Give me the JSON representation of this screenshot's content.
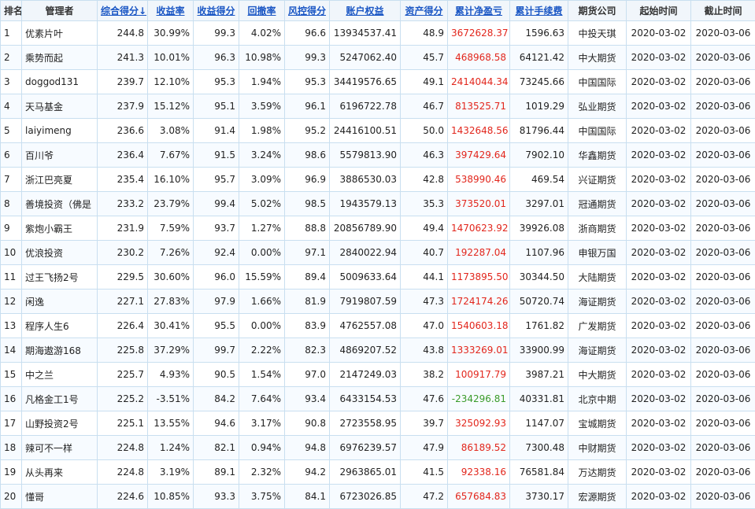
{
  "columns": [
    {
      "label": "排名",
      "sortable": false
    },
    {
      "label": "管理者",
      "sortable": false
    },
    {
      "label": "综合得分↓",
      "sortable": true
    },
    {
      "label": "收益率",
      "sortable": true
    },
    {
      "label": "收益得分",
      "sortable": true
    },
    {
      "label": "回撤率",
      "sortable": true
    },
    {
      "label": "风控得分",
      "sortable": true
    },
    {
      "label": "账户权益",
      "sortable": true
    },
    {
      "label": "资产得分",
      "sortable": true
    },
    {
      "label": "累计净盈亏",
      "sortable": true
    },
    {
      "label": "累计手续费",
      "sortable": true
    },
    {
      "label": "期货公司",
      "sortable": false
    },
    {
      "label": "起始时间",
      "sortable": false
    },
    {
      "label": "截止时间",
      "sortable": false
    }
  ],
  "colors": {
    "profit_positive": "#e2261c",
    "profit_negative": "#3a9b2a",
    "header_link": "#1a56c4",
    "border": "#c9dff0"
  },
  "rows": [
    {
      "rank": "1",
      "manager": "优素片叶",
      "score": "244.8",
      "return": "30.99%",
      "return_score": "99.3",
      "drawdown": "4.02%",
      "risk_score": "96.6",
      "equity": "13934537.41",
      "asset_score": "48.9",
      "net_pnl": "3672628.37",
      "fee": "1596.63",
      "broker": "中投天琪",
      "start": "2020-03-02",
      "end": "2020-03-06"
    },
    {
      "rank": "2",
      "manager": "乘势而起",
      "score": "241.3",
      "return": "10.01%",
      "return_score": "96.3",
      "drawdown": "10.98%",
      "risk_score": "99.3",
      "equity": "5247062.40",
      "asset_score": "45.7",
      "net_pnl": "468968.58",
      "fee": "64121.42",
      "broker": "中大期货",
      "start": "2020-03-02",
      "end": "2020-03-06"
    },
    {
      "rank": "3",
      "manager": "doggod131",
      "score": "239.7",
      "return": "12.10%",
      "return_score": "95.3",
      "drawdown": "1.94%",
      "risk_score": "95.3",
      "equity": "34419576.65",
      "asset_score": "49.1",
      "net_pnl": "2414044.34",
      "fee": "73245.66",
      "broker": "中国国际",
      "start": "2020-03-02",
      "end": "2020-03-06"
    },
    {
      "rank": "4",
      "manager": "天马基金",
      "score": "237.9",
      "return": "15.12%",
      "return_score": "95.1",
      "drawdown": "3.59%",
      "risk_score": "96.1",
      "equity": "6196722.78",
      "asset_score": "46.7",
      "net_pnl": "813525.71",
      "fee": "1019.29",
      "broker": "弘业期货",
      "start": "2020-03-02",
      "end": "2020-03-06"
    },
    {
      "rank": "5",
      "manager": "laiyimeng",
      "score": "236.6",
      "return": "3.08%",
      "return_score": "91.4",
      "drawdown": "1.98%",
      "risk_score": "95.2",
      "equity": "24416100.51",
      "asset_score": "50.0",
      "net_pnl": "1432648.56",
      "fee": "81796.44",
      "broker": "中国国际",
      "start": "2020-03-02",
      "end": "2020-03-06"
    },
    {
      "rank": "6",
      "manager": "百川爷",
      "score": "236.4",
      "return": "7.67%",
      "return_score": "91.5",
      "drawdown": "3.24%",
      "risk_score": "98.6",
      "equity": "5579813.90",
      "asset_score": "46.3",
      "net_pnl": "397429.64",
      "fee": "7902.10",
      "broker": "华鑫期货",
      "start": "2020-03-02",
      "end": "2020-03-06"
    },
    {
      "rank": "7",
      "manager": "浙江巴亮夏",
      "score": "235.4",
      "return": "16.10%",
      "return_score": "95.7",
      "drawdown": "3.09%",
      "risk_score": "96.9",
      "equity": "3886530.03",
      "asset_score": "42.8",
      "net_pnl": "538990.46",
      "fee": "469.54",
      "broker": "兴证期货",
      "start": "2020-03-02",
      "end": "2020-03-06"
    },
    {
      "rank": "8",
      "manager": "善境投资（佛是",
      "score": "233.2",
      "return": "23.79%",
      "return_score": "99.4",
      "drawdown": "5.02%",
      "risk_score": "98.5",
      "equity": "1943579.13",
      "asset_score": "35.3",
      "net_pnl": "373520.01",
      "fee": "3297.01",
      "broker": "冠通期货",
      "start": "2020-03-02",
      "end": "2020-03-06"
    },
    {
      "rank": "9",
      "manager": "紫炮小霸王",
      "score": "231.9",
      "return": "7.59%",
      "return_score": "93.7",
      "drawdown": "1.27%",
      "risk_score": "88.8",
      "equity": "20856789.90",
      "asset_score": "49.4",
      "net_pnl": "1470623.92",
      "fee": "39926.08",
      "broker": "浙商期货",
      "start": "2020-03-02",
      "end": "2020-03-06"
    },
    {
      "rank": "10",
      "manager": "优浪投资",
      "score": "230.2",
      "return": "7.26%",
      "return_score": "92.4",
      "drawdown": "0.00%",
      "risk_score": "97.1",
      "equity": "2840022.94",
      "asset_score": "40.7",
      "net_pnl": "192287.04",
      "fee": "1107.96",
      "broker": "申银万国",
      "start": "2020-03-02",
      "end": "2020-03-06"
    },
    {
      "rank": "11",
      "manager": "过王飞扬2号",
      "score": "229.5",
      "return": "30.60%",
      "return_score": "96.0",
      "drawdown": "15.59%",
      "risk_score": "89.4",
      "equity": "5009633.64",
      "asset_score": "44.1",
      "net_pnl": "1173895.50",
      "fee": "30344.50",
      "broker": "大陆期货",
      "start": "2020-03-02",
      "end": "2020-03-06"
    },
    {
      "rank": "12",
      "manager": "闲逸",
      "score": "227.1",
      "return": "27.83%",
      "return_score": "97.9",
      "drawdown": "1.66%",
      "risk_score": "81.9",
      "equity": "7919807.59",
      "asset_score": "47.3",
      "net_pnl": "1724174.26",
      "fee": "50720.74",
      "broker": "海证期货",
      "start": "2020-03-02",
      "end": "2020-03-06"
    },
    {
      "rank": "13",
      "manager": "程序人生6",
      "score": "226.4",
      "return": "30.41%",
      "return_score": "95.5",
      "drawdown": "0.00%",
      "risk_score": "83.9",
      "equity": "4762557.08",
      "asset_score": "47.0",
      "net_pnl": "1540603.18",
      "fee": "1761.82",
      "broker": "广发期货",
      "start": "2020-03-02",
      "end": "2020-03-06"
    },
    {
      "rank": "14",
      "manager": "期海遨游168",
      "score": "225.8",
      "return": "37.29%",
      "return_score": "99.7",
      "drawdown": "2.22%",
      "risk_score": "82.3",
      "equity": "4869207.52",
      "asset_score": "43.8",
      "net_pnl": "1333269.01",
      "fee": "33900.99",
      "broker": "海证期货",
      "start": "2020-03-02",
      "end": "2020-03-06"
    },
    {
      "rank": "15",
      "manager": "中之兰",
      "score": "225.7",
      "return": "4.93%",
      "return_score": "90.5",
      "drawdown": "1.54%",
      "risk_score": "97.0",
      "equity": "2147249.03",
      "asset_score": "38.2",
      "net_pnl": "100917.79",
      "fee": "3987.21",
      "broker": "中大期货",
      "start": "2020-03-02",
      "end": "2020-03-06"
    },
    {
      "rank": "16",
      "manager": "凡格金工1号",
      "score": "225.2",
      "return": "-3.51%",
      "return_score": "84.2",
      "drawdown": "7.64%",
      "risk_score": "93.4",
      "equity": "6433154.53",
      "asset_score": "47.6",
      "net_pnl": "-234296.81",
      "fee": "40331.81",
      "broker": "北京中期",
      "start": "2020-03-02",
      "end": "2020-03-06"
    },
    {
      "rank": "17",
      "manager": "山野投资2号",
      "score": "225.1",
      "return": "13.55%",
      "return_score": "94.6",
      "drawdown": "3.17%",
      "risk_score": "90.8",
      "equity": "2723558.95",
      "asset_score": "39.7",
      "net_pnl": "325092.93",
      "fee": "1147.07",
      "broker": "宝城期货",
      "start": "2020-03-02",
      "end": "2020-03-06"
    },
    {
      "rank": "18",
      "manager": "辣可不一样",
      "score": "224.8",
      "return": "1.24%",
      "return_score": "82.1",
      "drawdown": "0.94%",
      "risk_score": "94.8",
      "equity": "6976239.57",
      "asset_score": "47.9",
      "net_pnl": "86189.52",
      "fee": "7300.48",
      "broker": "中财期货",
      "start": "2020-03-02",
      "end": "2020-03-06"
    },
    {
      "rank": "19",
      "manager": "从头再来",
      "score": "224.8",
      "return": "3.19%",
      "return_score": "89.1",
      "drawdown": "2.32%",
      "risk_score": "94.2",
      "equity": "2963865.01",
      "asset_score": "41.5",
      "net_pnl": "92338.16",
      "fee": "76581.84",
      "broker": "万达期货",
      "start": "2020-03-02",
      "end": "2020-03-06"
    },
    {
      "rank": "20",
      "manager": "懂哥",
      "score": "224.6",
      "return": "10.85%",
      "return_score": "93.3",
      "drawdown": "3.75%",
      "risk_score": "84.1",
      "equity": "6723026.85",
      "asset_score": "47.2",
      "net_pnl": "657684.83",
      "fee": "3730.17",
      "broker": "宏源期货",
      "start": "2020-03-02",
      "end": "2020-03-06"
    }
  ]
}
